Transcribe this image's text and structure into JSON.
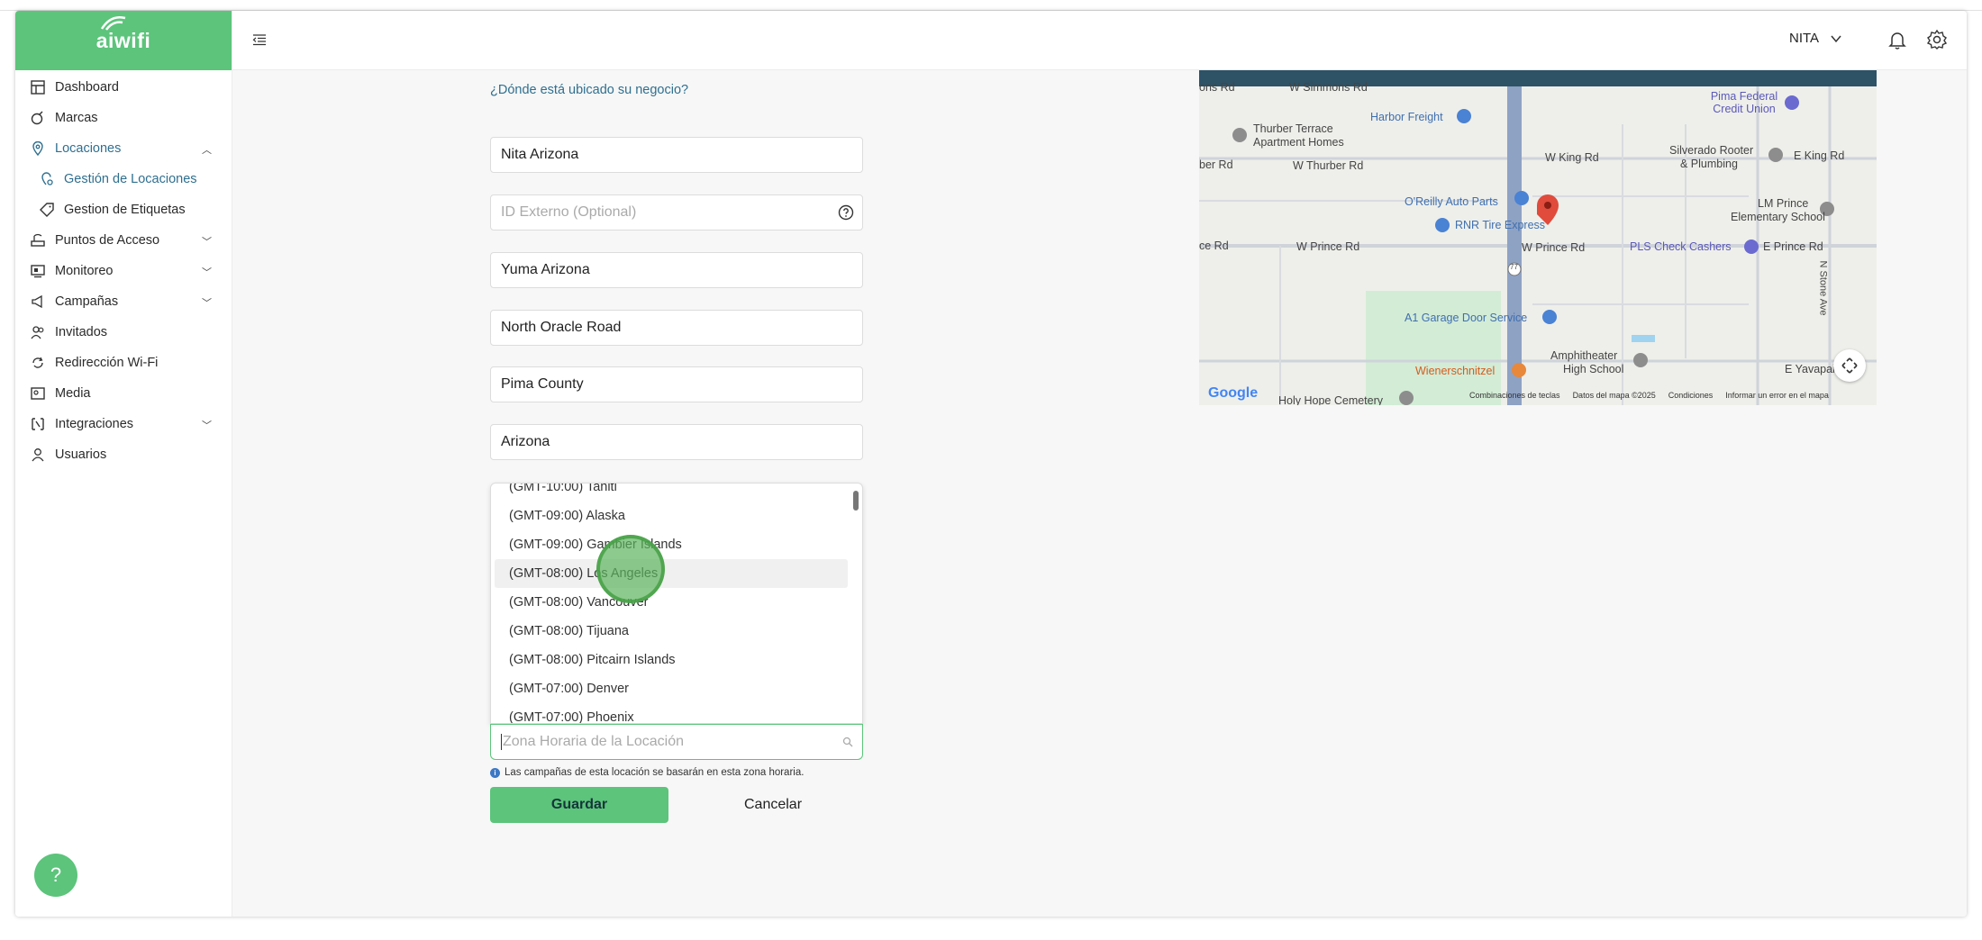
{
  "brand": {
    "logo_text": "aiwifi",
    "accent": "#5cc47b"
  },
  "sidebar": {
    "items": [
      {
        "label": "Dashboard",
        "icon": "dashboard-icon"
      },
      {
        "label": "Marcas",
        "icon": "tag-icon"
      },
      {
        "label": "Locaciones",
        "icon": "location-pin-icon",
        "expanded": true
      },
      {
        "label": "Gestión de Locaciones",
        "icon": "location-gear-icon"
      },
      {
        "label": "Gestion de Etiquetas",
        "icon": "label-icon"
      },
      {
        "label": "Puntos de Acceso",
        "icon": "router-icon"
      },
      {
        "label": "Monitoreo",
        "icon": "monitor-icon"
      },
      {
        "label": "Campañas",
        "icon": "megaphone-icon"
      },
      {
        "label": "Invitados",
        "icon": "users-icon"
      },
      {
        "label": "Redirección Wi-Fi",
        "icon": "redirect-icon"
      },
      {
        "label": "Media",
        "icon": "media-icon"
      },
      {
        "label": "Integraciones",
        "icon": "integration-icon"
      },
      {
        "label": "Usuarios",
        "icon": "user-icon"
      }
    ],
    "help_label": "?"
  },
  "header": {
    "user_name": "NITA"
  },
  "form": {
    "question": "¿Dónde está ubicado su negocio?",
    "name_value": "Nita Arizona",
    "external_id_placeholder": "ID Externo (Optional)",
    "city_value": "Yuma Arizona",
    "street_value": "North Oracle Road",
    "county_value": "Pima County",
    "state_value": "Arizona",
    "timezone_placeholder": "Zona Horaria de la Locación",
    "timezone_options": [
      "(GMT-10:00) Tahiti",
      "(GMT-09:00) Alaska",
      "(GMT-09:00) Gambier Islands",
      "(GMT-08:00) Los Angeles",
      "(GMT-08:00) Vancouver",
      "(GMT-08:00) Tijuana",
      "(GMT-08:00) Pitcairn Islands",
      "(GMT-07:00) Denver",
      "(GMT-07:00) Phoenix"
    ],
    "info_text": "Las campañas de esta locación se basarán en esta zona horaria.",
    "save_label": "Guardar",
    "cancel_label": "Cancelar"
  },
  "map": {
    "labels": {
      "simmons": "W Simmons Rd",
      "simmons_left": "ons Rd",
      "harbor": "Harbor Freight",
      "pima": "Pima Federal Credit Union",
      "thurber_homes_1": "Thurber Terrace",
      "thurber_homes_2": "Apartment Homes",
      "thurber_rd": "W Thurber Rd",
      "ber_rd": "ber Rd",
      "king": "W King Rd",
      "silverado_1": "Silverado Rooter",
      "silverado_2": "& Plumbing",
      "e_king": "E King Rd",
      "oreilly": "O'Reilly Auto Parts",
      "lm_1": "LM Prince",
      "lm_2": "Elementary School",
      "rnr": "RNR Tire Express",
      "ce_rd": "ce Rd",
      "w_prince_1": "W Prince Rd",
      "w_prince_2": "W Prince Rd",
      "pls": "PLS Check Cashers",
      "e_prince": "E Prince Rd",
      "a1": "A1 Garage Door Service",
      "stone": "N Stone Ave",
      "amph_1": "Amphitheater",
      "amph_2": "High School",
      "wiener": "Wienerschnitzel",
      "yavapai": "E Yavapai R",
      "holy": "Holy Hope Cemetery",
      "route": "77"
    },
    "google": "Google",
    "footer": [
      "Combinaciones de teclas",
      "Datos del mapa ©2025",
      "Condiciones",
      "Informar un error en el mapa"
    ]
  }
}
